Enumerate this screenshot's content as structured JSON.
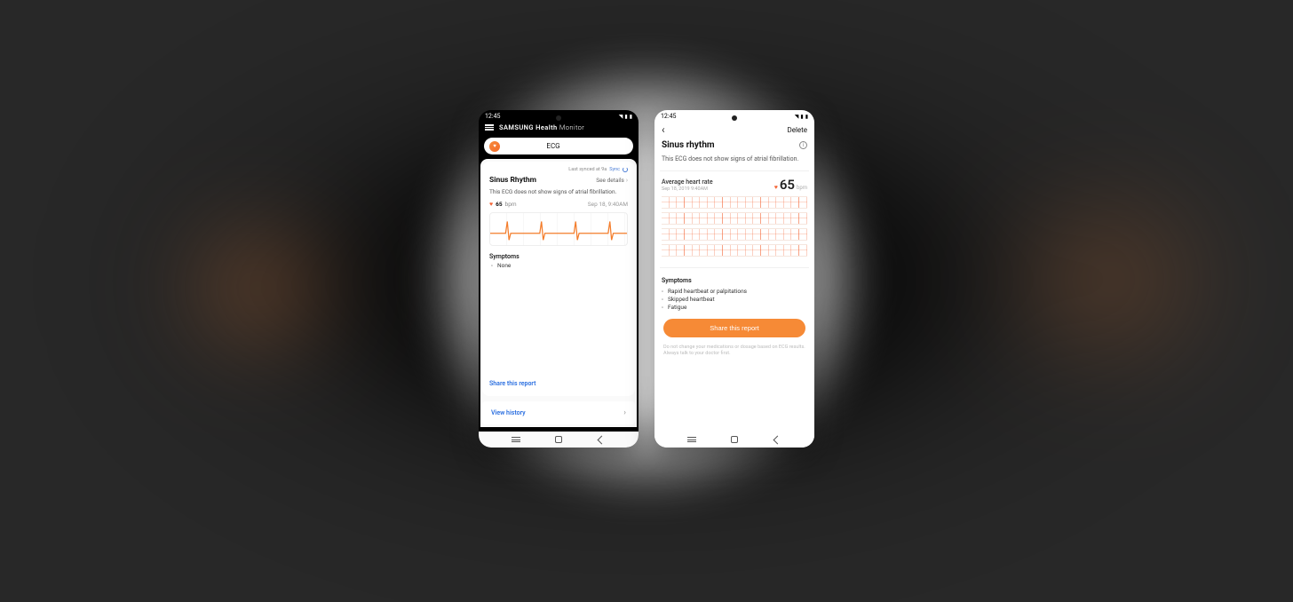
{
  "phone1": {
    "status_time": "12:45",
    "app_brand": "SAMSUNG",
    "app_name": "Health",
    "app_sub": "Monitor",
    "pill_label": "ECG",
    "sync_prefix": "Last synced at 9a",
    "sync_label": "Sync",
    "card_title": "Sinus Rhythm",
    "see_details": "See details",
    "desc": "This ECG does not show signs of atrial fibrillation.",
    "bpm_value": "65",
    "bpm_unit": "bpm",
    "timestamp": "Sep 18, 9:40AM",
    "symptoms_title": "Symptoms",
    "symptoms": [
      "None"
    ],
    "share_link": "Share this report",
    "history_label": "View history"
  },
  "phone2": {
    "status_time": "12:45",
    "delete_label": "Delete",
    "title": "Sinus rhythm",
    "desc": "This ECG does not show signs of atrial fibrillation.",
    "ahr_label": "Average heart rate",
    "ahr_timestamp": "Sep 18, 2019 9:40AM",
    "bpm_value": "65",
    "bpm_unit": "bpm",
    "symptoms_title": "Symptoms",
    "symptoms": [
      "Rapid heartbeat or palpitations",
      "Skipped heartbeat",
      "Fatigue"
    ],
    "share_button": "Share this report",
    "disclaimer": "Do not change your medications or dosage based on ECG results. Always talk to your doctor first."
  }
}
